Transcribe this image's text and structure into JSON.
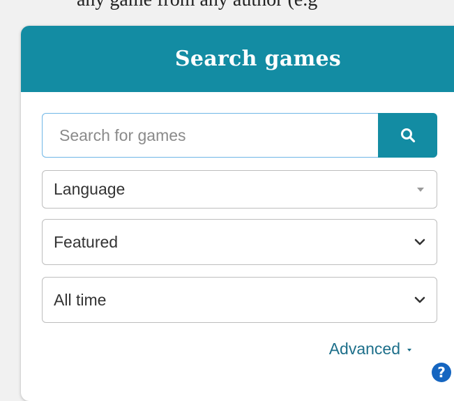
{
  "page": {
    "top_text": "any game from any author (e.g"
  },
  "panel": {
    "title": "Search games"
  },
  "search": {
    "placeholder": "Search for games",
    "value": ""
  },
  "filters": {
    "language_label": "Language",
    "sort_label": "Featured",
    "time_label": "All time"
  },
  "advanced": {
    "label": "Advanced"
  },
  "colors": {
    "accent": "#138ca3",
    "link": "#1d6f8a",
    "help": "#1565c0"
  },
  "icons": {
    "search": "search-icon",
    "dropdown": "chevron-down-icon",
    "help": "help-icon"
  }
}
